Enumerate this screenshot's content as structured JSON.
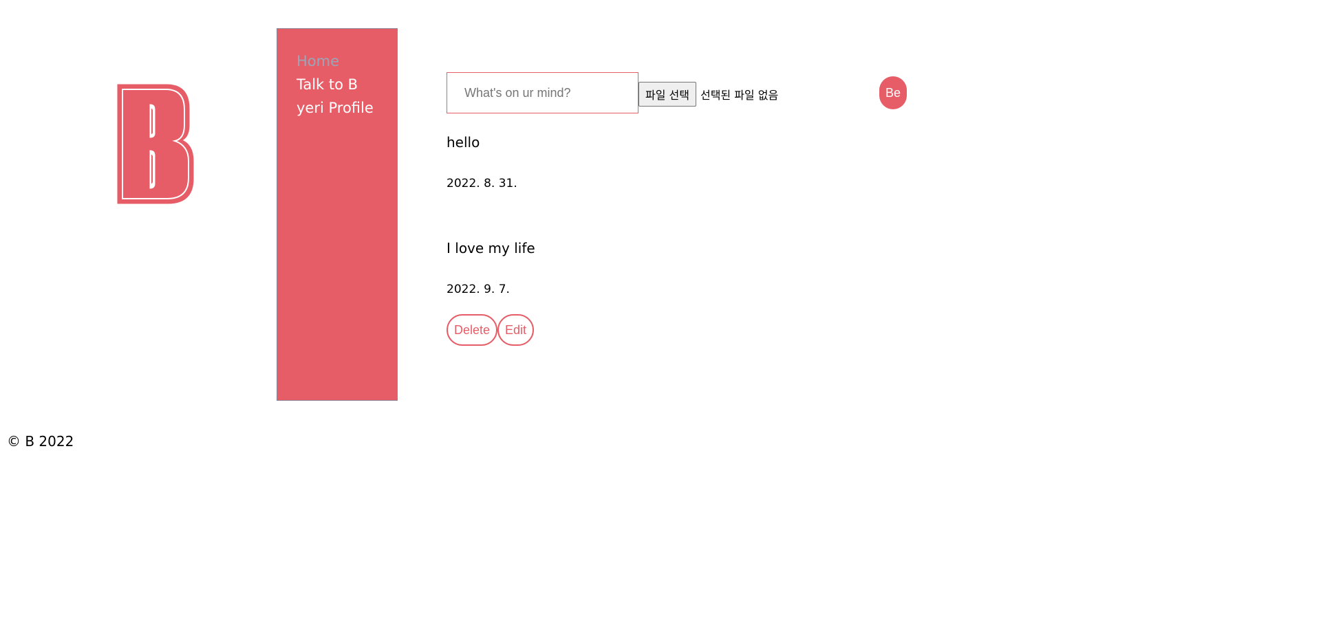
{
  "logo": {
    "letter": "B",
    "icon": "b-letter-logo",
    "color": "#e65d67"
  },
  "sidebar": {
    "background": "#e65d67",
    "items": [
      {
        "label": "Home",
        "active": true
      },
      {
        "label": "Talk to B",
        "active": false
      },
      {
        "label": "yeri Profile",
        "active": false
      }
    ]
  },
  "composer": {
    "placeholder": "What's on ur mind?",
    "value": "",
    "file_button_label": "파일 선택",
    "file_status": "선택된 파일 없음",
    "submit_label": "Be"
  },
  "posts": [
    {
      "text": "hello",
      "date": "2022. 8. 31."
    },
    {
      "text": "I love my life",
      "date": "2022. 9. 7.",
      "actions": {
        "delete_label": "Delete",
        "edit_label": "Edit"
      }
    }
  ],
  "footer": {
    "text": "© B 2022"
  },
  "colors": {
    "accent": "#e65d67",
    "active_nav": "#9aa6b8"
  }
}
